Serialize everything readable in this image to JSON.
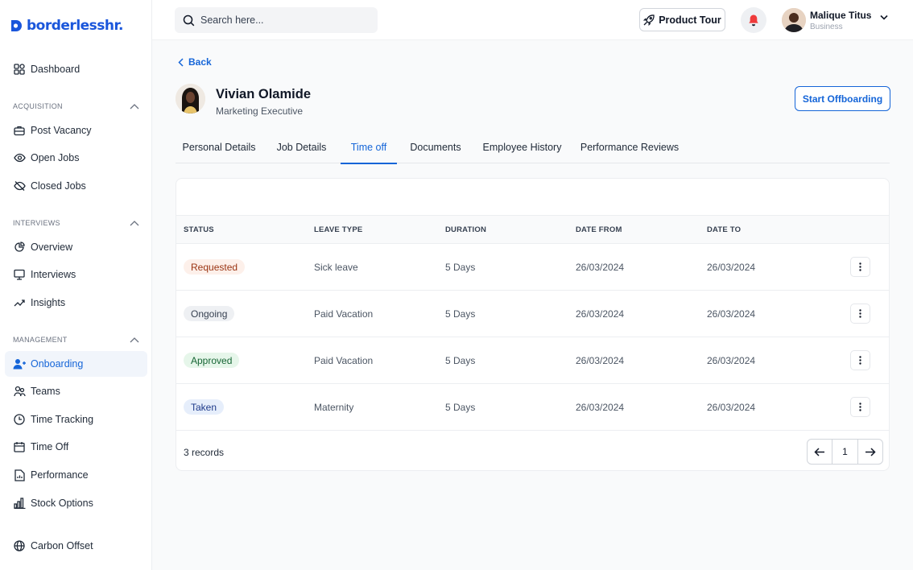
{
  "brand": {
    "name": "borderlesshr.",
    "color": "#1a56db"
  },
  "search": {
    "placeholder": "Search here..."
  },
  "header": {
    "product_tour": "Product Tour",
    "user_name": "Malique Titus",
    "user_role": "Business"
  },
  "sidebar": {
    "top": [
      {
        "label": "Dashboard",
        "icon": "grid-icon"
      }
    ],
    "sections": [
      {
        "title": "ACQUISITION",
        "items": [
          {
            "label": "Post Vacancy",
            "icon": "briefcase-icon"
          },
          {
            "label": "Open Jobs",
            "icon": "eye-icon"
          },
          {
            "label": "Closed Jobs",
            "icon": "eye-off-icon"
          }
        ]
      },
      {
        "title": "INTERVIEWS",
        "items": [
          {
            "label": "Overview",
            "icon": "pie-chart-icon"
          },
          {
            "label": "Interviews",
            "icon": "monitor-icon"
          },
          {
            "label": "Insights",
            "icon": "trend-icon"
          }
        ]
      },
      {
        "title": "MANAGEMENT",
        "items": [
          {
            "label": "Onboarding",
            "icon": "user-plus-icon",
            "active": true
          },
          {
            "label": "Teams",
            "icon": "users-icon"
          },
          {
            "label": "Time Tracking",
            "icon": "clock-icon"
          },
          {
            "label": "Time Off",
            "icon": "calendar-icon"
          },
          {
            "label": "Performance",
            "icon": "file-chart-icon"
          },
          {
            "label": "Stock Options",
            "icon": "bar-chart-icon"
          }
        ]
      }
    ],
    "bottom": [
      {
        "label": "Carbon Offset",
        "icon": "globe-icon"
      }
    ]
  },
  "page": {
    "back_label": "Back",
    "employee_name": "Vivian Olamide",
    "employee_title": "Marketing Executive",
    "offboarding_label": "Start Offboarding"
  },
  "tabs": [
    "Personal Details",
    "Job Details",
    "Time off",
    "Documents",
    "Employee History",
    "Performance Reviews"
  ],
  "active_tab": "Time off",
  "table": {
    "columns": [
      "STATUS",
      "LEAVE TYPE",
      "DURATION",
      "DATE FROM",
      "DATE TO"
    ],
    "rows": [
      {
        "status": "Requested",
        "leave_type": "Sick leave",
        "duration": "5 Days",
        "date_from": "26/03/2024",
        "date_to": "26/03/2024"
      },
      {
        "status": "Ongoing",
        "leave_type": "Paid Vacation",
        "duration": "5 Days",
        "date_from": "26/03/2024",
        "date_to": "26/03/2024"
      },
      {
        "status": "Approved",
        "leave_type": "Paid Vacation",
        "duration": "5 Days",
        "date_from": "26/03/2024",
        "date_to": "26/03/2024"
      },
      {
        "status": "Taken",
        "leave_type": "Maternity",
        "duration": "5 Days",
        "date_from": "26/03/2024",
        "date_to": "26/03/2024"
      }
    ],
    "records_label": "3 records",
    "current_page": "1"
  },
  "colors": {
    "accent": "#1565d8",
    "requested_bg": "#fdf0ea",
    "requested_fg": "#9a3412",
    "ongoing_bg": "#eef0f3",
    "ongoing_fg": "#374151",
    "approved_bg": "#e6f6ea",
    "approved_fg": "#166534",
    "taken_bg": "#e6eefb",
    "taken_fg": "#1e3a8a"
  }
}
